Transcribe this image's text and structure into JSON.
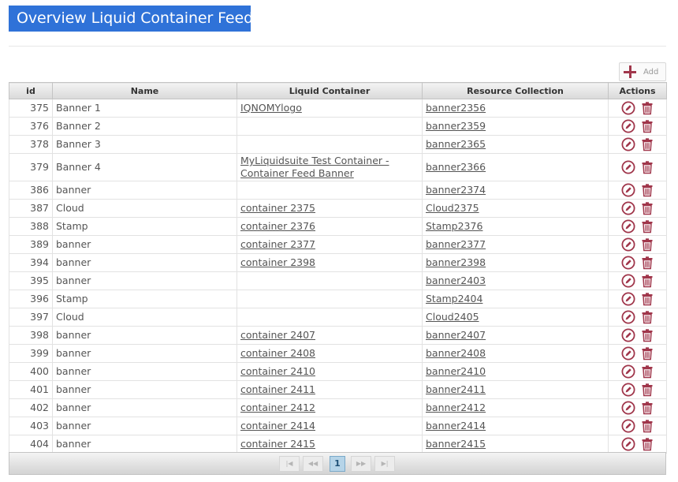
{
  "page": {
    "title": "Overview Liquid Container Feeds"
  },
  "toolbar": {
    "add_label": "Add"
  },
  "table": {
    "columns": {
      "id": "id",
      "name": "Name",
      "liquid_container": "Liquid Container",
      "resource_collection": "Resource Collection",
      "actions": "Actions"
    },
    "rows": [
      {
        "id": "375",
        "name": "Banner 1",
        "liquid_container": "IQNOMYlogo",
        "resource_collection": "banner2356"
      },
      {
        "id": "376",
        "name": "Banner 2",
        "liquid_container": "",
        "resource_collection": "banner2359"
      },
      {
        "id": "378",
        "name": "Banner 3",
        "liquid_container": "",
        "resource_collection": "banner2365"
      },
      {
        "id": "379",
        "name": "Banner 4",
        "liquid_container": "MyLiquidsuite Test Container - Container Feed Banner",
        "resource_collection": "banner2366"
      },
      {
        "id": "386",
        "name": "banner",
        "liquid_container": "",
        "resource_collection": "banner2374"
      },
      {
        "id": "387",
        "name": "Cloud",
        "liquid_container": "container 2375",
        "resource_collection": "Cloud2375"
      },
      {
        "id": "388",
        "name": "Stamp",
        "liquid_container": "container 2376",
        "resource_collection": "Stamp2376"
      },
      {
        "id": "389",
        "name": "banner",
        "liquid_container": "container 2377",
        "resource_collection": "banner2377"
      },
      {
        "id": "394",
        "name": "banner",
        "liquid_container": "container 2398",
        "resource_collection": "banner2398"
      },
      {
        "id": "395",
        "name": "banner",
        "liquid_container": "",
        "resource_collection": "banner2403"
      },
      {
        "id": "396",
        "name": "Stamp",
        "liquid_container": "",
        "resource_collection": "Stamp2404"
      },
      {
        "id": "397",
        "name": "Cloud",
        "liquid_container": "",
        "resource_collection": "Cloud2405"
      },
      {
        "id": "398",
        "name": "banner",
        "liquid_container": "container 2407",
        "resource_collection": "banner2407"
      },
      {
        "id": "399",
        "name": "banner",
        "liquid_container": "container 2408",
        "resource_collection": "banner2408"
      },
      {
        "id": "400",
        "name": "banner",
        "liquid_container": "container 2410",
        "resource_collection": "banner2410"
      },
      {
        "id": "401",
        "name": "banner",
        "liquid_container": "container 2411",
        "resource_collection": "banner2411"
      },
      {
        "id": "402",
        "name": "banner",
        "liquid_container": "container 2412",
        "resource_collection": "banner2412"
      },
      {
        "id": "403",
        "name": "banner",
        "liquid_container": "container 2414",
        "resource_collection": "banner2414"
      },
      {
        "id": "404",
        "name": "banner",
        "liquid_container": "container 2415",
        "resource_collection": "banner2415"
      }
    ],
    "row_actions": [
      "edit-icon",
      "trash-icon"
    ]
  },
  "pager": {
    "current_page": "1",
    "buttons": [
      "first-page-icon",
      "previous-page-icon",
      "next-page-icon",
      "last-page-icon"
    ]
  },
  "colors": {
    "title_bg": "#2f72d8",
    "accent": "#a0364b",
    "header_bg": "#dcdcdc",
    "pager_current": "#b6d4e8"
  }
}
